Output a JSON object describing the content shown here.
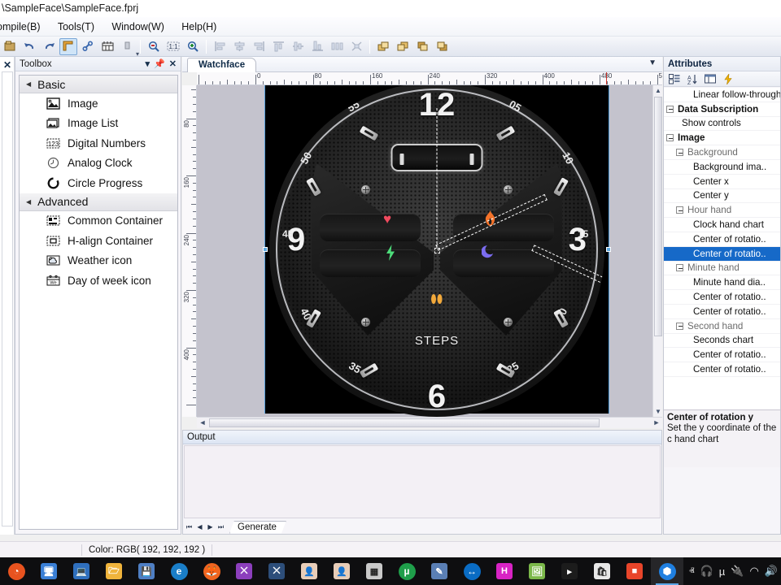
{
  "window": {
    "title": "\\SampleFace\\SampleFace.fprj"
  },
  "menu": {
    "items": [
      {
        "label": "ompile(B)"
      },
      {
        "label": "Tools(T)"
      },
      {
        "label": "Window(W)"
      },
      {
        "label": "Help(H)"
      }
    ]
  },
  "toolbar": {
    "buttons": [
      {
        "name": "open-project",
        "glyph": "❐",
        "state": "normal"
      },
      {
        "name": "undo",
        "glyph": "↶",
        "state": "normal"
      },
      {
        "name": "redo",
        "glyph": "↷",
        "state": "normal"
      },
      {
        "name": "select-frame",
        "glyph": "⌐",
        "state": "selected"
      },
      {
        "name": "link",
        "glyph": "🔗",
        "state": "normal"
      },
      {
        "name": "grid",
        "glyph": "☷",
        "state": "normal"
      },
      {
        "name": "dropdown-more",
        "glyph": "▮",
        "state": "normal"
      },
      {
        "name": "zoom-out",
        "glyph": "⊖",
        "state": "normal"
      },
      {
        "name": "zoom-actual",
        "glyph": "1:1",
        "state": "normal"
      },
      {
        "name": "zoom-in",
        "glyph": "⊕",
        "state": "normal"
      },
      {
        "name": "align-left",
        "glyph": "☰",
        "state": "disabled"
      },
      {
        "name": "align-center-h",
        "glyph": "☷",
        "state": "disabled"
      },
      {
        "name": "align-right",
        "glyph": "☰",
        "state": "disabled"
      },
      {
        "name": "align-top",
        "glyph": "⤒",
        "state": "disabled"
      },
      {
        "name": "align-middle-v",
        "glyph": "≡",
        "state": "disabled"
      },
      {
        "name": "align-bottom",
        "glyph": "⤓",
        "state": "disabled"
      },
      {
        "name": "distribute-h",
        "glyph": "⚌",
        "state": "disabled"
      },
      {
        "name": "distribute-v",
        "glyph": "⨍",
        "state": "disabled"
      },
      {
        "name": "bring-to-front",
        "glyph": "❐",
        "state": "normal"
      },
      {
        "name": "send-to-back",
        "glyph": "❑",
        "state": "normal"
      },
      {
        "name": "bring-forward",
        "glyph": "◰",
        "state": "normal"
      },
      {
        "name": "send-backward",
        "glyph": "◱",
        "state": "normal"
      }
    ]
  },
  "toolbox": {
    "title": "Toolbox",
    "header_buttons": [
      {
        "name": "toolbox-menu-icon",
        "glyph": "▾"
      },
      {
        "name": "toolbox-pin-icon",
        "glyph": "⚑"
      },
      {
        "name": "toolbox-close-icon",
        "glyph": "✕"
      }
    ],
    "groups": [
      {
        "label": "Basic",
        "expanded": true,
        "items": [
          {
            "label": "Image",
            "icon": "image-icon"
          },
          {
            "label": "Image List",
            "icon": "image-list-icon"
          },
          {
            "label": "Digital Numbers",
            "icon": "digital-numbers-icon"
          },
          {
            "label": "Analog Clock",
            "icon": "analog-clock-icon"
          },
          {
            "label": "Circle Progress",
            "icon": "circle-progress-icon"
          }
        ]
      },
      {
        "label": "Advanced",
        "expanded": true,
        "items": [
          {
            "label": "Common Container",
            "icon": "common-container-icon"
          },
          {
            "label": "H-align Container",
            "icon": "h-align-container-icon"
          },
          {
            "label": "Weather icon",
            "icon": "weather-icon"
          },
          {
            "label": "Day of week icon",
            "icon": "day-of-week-icon"
          }
        ]
      }
    ]
  },
  "editor": {
    "tab_label": "Watchface",
    "ruler_h_labels": [
      "0",
      "80",
      "160",
      "240",
      "320",
      "400",
      "480"
    ],
    "ruler_v_labels": [
      "80",
      "160",
      "240",
      "320",
      "400"
    ]
  },
  "watchface": {
    "hour_numerals": [
      "12",
      "3",
      "6",
      "9"
    ],
    "minute_labels": [
      "05",
      "10",
      "15",
      "20",
      "25",
      "35",
      "40",
      "45",
      "50",
      "55"
    ],
    "complication_label": "STEPS",
    "icons": [
      {
        "name": "heart-rate-icon",
        "glyph": "♥",
        "color": "#f04a5e"
      },
      {
        "name": "calories-flame-icon",
        "glyph": "🔥",
        "color": "#f4732a"
      },
      {
        "name": "battery-bolt-icon",
        "glyph": "⚡",
        "color": "#4ddc7a"
      },
      {
        "name": "sleep-moon-icon",
        "glyph": "☽",
        "color": "#7b6cf0"
      },
      {
        "name": "steps-feet-icon",
        "glyph": "👣",
        "color": "#f2a93b"
      }
    ]
  },
  "output": {
    "title": "Output",
    "nav_buttons": [
      {
        "name": "first-page-button",
        "glyph": "⏮"
      },
      {
        "name": "prev-page-button",
        "glyph": "◀"
      },
      {
        "name": "next-page-button",
        "glyph": "▶"
      },
      {
        "name": "last-page-button",
        "glyph": "⏭"
      }
    ],
    "tabs": [
      {
        "label": "Generate",
        "selected": true
      }
    ]
  },
  "attributes": {
    "title": "Attributes",
    "tools": [
      {
        "name": "categorized-view-icon",
        "glyph": "⊞"
      },
      {
        "name": "sort-alphabetical-icon",
        "glyph": "↓"
      },
      {
        "name": "property-pages-icon",
        "glyph": "▤"
      },
      {
        "name": "events-icon",
        "glyph": "⚡"
      }
    ],
    "rows": [
      {
        "label": "Linear follow-through o..",
        "type": "leaf"
      },
      {
        "label": "Data Subscription",
        "type": "cat"
      },
      {
        "label": "Show controls",
        "type": "leaf2"
      },
      {
        "label": "Image",
        "type": "cat"
      },
      {
        "label": "Background",
        "type": "sub"
      },
      {
        "label": "Background ima..",
        "type": "leaf"
      },
      {
        "label": "Center x",
        "type": "leaf"
      },
      {
        "label": "Center y",
        "type": "leaf"
      },
      {
        "label": "Hour hand",
        "type": "sub"
      },
      {
        "label": "Clock hand chart",
        "type": "leaf"
      },
      {
        "label": "Center of rotatio..",
        "type": "leaf"
      },
      {
        "label": "Center of rotatio..",
        "type": "leaf",
        "selected": true
      },
      {
        "label": "Minute hand",
        "type": "sub"
      },
      {
        "label": "Minute hand dia..",
        "type": "leaf"
      },
      {
        "label": "Center of rotatio..",
        "type": "leaf"
      },
      {
        "label": "Center of rotatio..",
        "type": "leaf"
      },
      {
        "label": "Second hand",
        "type": "sub"
      },
      {
        "label": "Seconds chart",
        "type": "leaf"
      },
      {
        "label": "Center of rotatio..",
        "type": "leaf"
      },
      {
        "label": "Center of rotatio..",
        "type": "leaf"
      }
    ],
    "description": {
      "title": "Center of rotation y",
      "text": "Set the y coordinate of the c\nhand chart"
    }
  },
  "statusbar": {
    "color_text": "Color: RGB( 192, 192, 192 )"
  },
  "taskbar": {
    "items": [
      {
        "name": "taskbar-start-icon",
        "glyph": "◔",
        "color": "#e8531f",
        "shape": "circ"
      },
      {
        "name": "taskbar-remote-desktop-icon",
        "glyph": "🖥",
        "color": "#3a7fd5",
        "shape": "sq"
      },
      {
        "name": "taskbar-network-computer-icon",
        "glyph": "💻",
        "color": "#2f6fbd",
        "shape": "sq"
      },
      {
        "name": "taskbar-file-explorer-icon",
        "glyph": "🗁",
        "color": "#f0b43c",
        "shape": "sq"
      },
      {
        "name": "taskbar-save-disk-icon",
        "glyph": "💾",
        "color": "#4f7fc4",
        "shape": "sq"
      },
      {
        "name": "taskbar-edge-icon",
        "glyph": "e",
        "color": "#1a7ec8",
        "shape": "circ"
      },
      {
        "name": "taskbar-firefox-icon",
        "glyph": "🦊",
        "color": "#f0651f",
        "shape": "circ"
      },
      {
        "name": "taskbar-visual-studio-icon",
        "glyph": "⨉",
        "color": "#8c3fbd",
        "shape": "sq"
      },
      {
        "name": "taskbar-vscode-icon",
        "glyph": "⨉",
        "color": "#2d4e7a",
        "shape": "sq"
      },
      {
        "name": "taskbar-face-profile-icon",
        "glyph": "👤",
        "color": "#e8cdb8",
        "shape": "sq"
      },
      {
        "name": "taskbar-face-profile-2-icon",
        "glyph": "👤",
        "color": "#e8cdb8",
        "shape": "sq"
      },
      {
        "name": "taskbar-app-window-icon",
        "glyph": "▦",
        "color": "#c9c9c9",
        "shape": "sq"
      },
      {
        "name": "taskbar-utorrent-icon",
        "glyph": "µ",
        "color": "#1f9e4a",
        "shape": "circ"
      },
      {
        "name": "taskbar-editor-icon",
        "glyph": "✎",
        "color": "#5a7fb5",
        "shape": "sq"
      },
      {
        "name": "taskbar-teamviewer-icon",
        "glyph": "↔",
        "color": "#0a6cc4",
        "shape": "circ"
      },
      {
        "name": "taskbar-hex-editor-icon",
        "glyph": "H",
        "color": "#d823c4",
        "shape": "sq"
      },
      {
        "name": "taskbar-image-editor-icon",
        "glyph": "🖼",
        "color": "#7bb84a",
        "shape": "sq"
      },
      {
        "name": "taskbar-terminal-icon",
        "glyph": "▸",
        "color": "#1c1c1c",
        "shape": "sq"
      },
      {
        "name": "taskbar-microsoft-store-icon",
        "glyph": "🛍",
        "color": "#e8e8e8",
        "shape": "sq"
      },
      {
        "name": "taskbar-media-player-icon",
        "glyph": "■",
        "color": "#e8452a",
        "shape": "sq"
      },
      {
        "name": "taskbar-active-app-icon",
        "glyph": "⬢",
        "color": "#1f7fe0",
        "shape": "circ",
        "active": true
      }
    ],
    "tray": [
      {
        "name": "tray-show-hidden-icon",
        "glyph": "ⱏ"
      },
      {
        "name": "tray-headset-icon",
        "glyph": "🎧"
      },
      {
        "name": "tray-utorrent-icon",
        "glyph": "µ"
      },
      {
        "name": "tray-battery-icon",
        "glyph": "🔌"
      },
      {
        "name": "tray-wifi-icon",
        "glyph": "◠"
      },
      {
        "name": "tray-volume-icon",
        "glyph": "🔊"
      }
    ]
  }
}
